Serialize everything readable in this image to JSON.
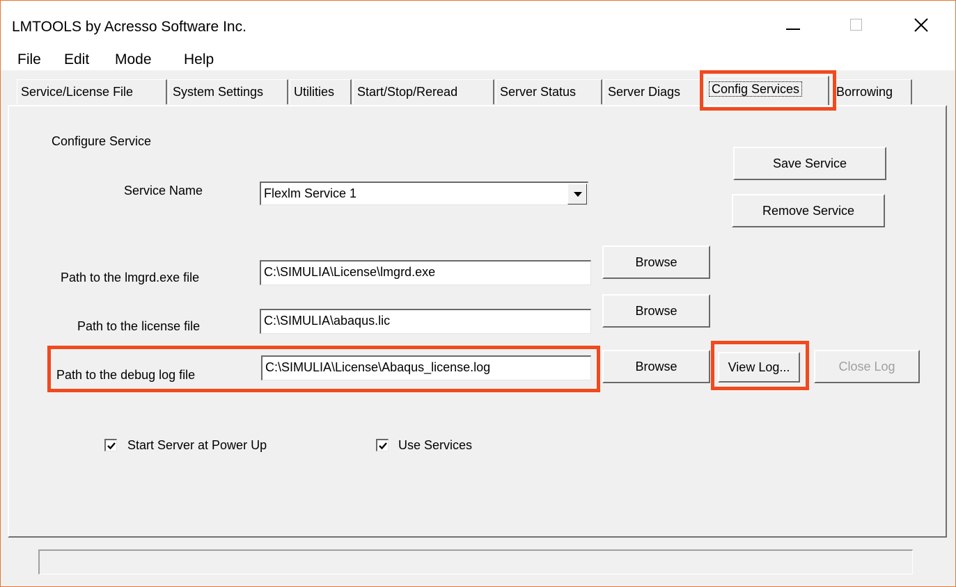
{
  "window": {
    "title": "LMTOOLS by Acresso Software Inc."
  },
  "menu": {
    "items": [
      "File",
      "Edit",
      "Mode",
      "Help"
    ]
  },
  "tabs": [
    "Service/License File",
    "System Settings",
    "Utilities",
    "Start/Stop/Reread",
    "Server Status",
    "Server Diags",
    "Config Services",
    "Borrowing"
  ],
  "active_tab": "Config Services",
  "config": {
    "section_label": "Configure Service",
    "service_name_label": "Service Name",
    "service_name_value": "Flexlm Service 1",
    "lmgrd_label": "Path to the lmgrd.exe file",
    "lmgrd_value": "C:\\SIMULIA\\License\\lmgrd.exe",
    "license_label": "Path to the license file",
    "license_value": "C:\\SIMULIA\\abaqus.lic",
    "debug_label": "Path to the debug log file",
    "debug_value": "C:\\SIMULIA\\License\\Abaqus_license.log",
    "save_service": "Save Service",
    "remove_service": "Remove Service",
    "browse": "Browse",
    "view_log": "View Log...",
    "close_log": "Close Log",
    "start_server_label": "Start Server at Power Up",
    "start_server_checked": true,
    "use_services_label": "Use Services",
    "use_services_checked": true
  },
  "status": {
    "text": ""
  },
  "colors": {
    "highlight": "#f04a1e",
    "window_bg": "#f0f0f0",
    "window_border": "#e8752c"
  }
}
